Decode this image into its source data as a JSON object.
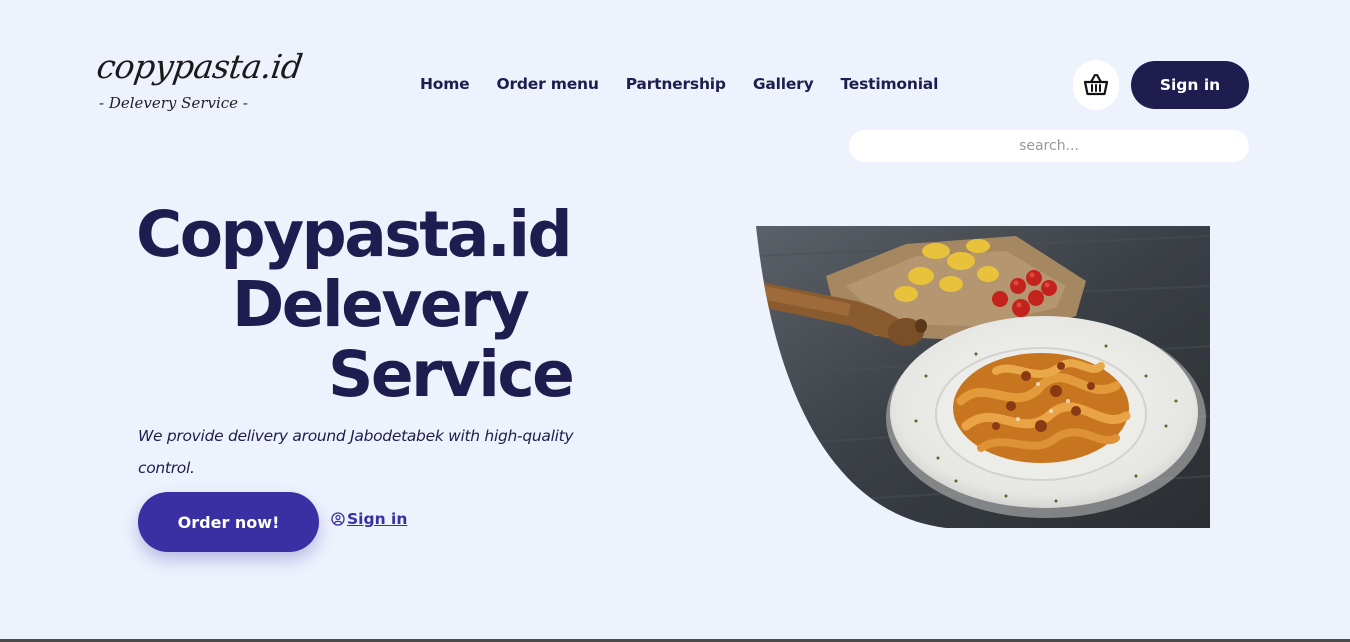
{
  "logo": {
    "title": "copypasta.id",
    "subtitle": "- Delevery Service -"
  },
  "nav": {
    "items": [
      "Home",
      "Order menu",
      "Partnership",
      "Gallery",
      "Testimonial"
    ]
  },
  "header": {
    "cart_icon": "basket-icon",
    "signin_label": "Sign in",
    "search_placeholder": "search..."
  },
  "hero": {
    "title_line1": "Copypasta.id",
    "title_line2": "Delevery",
    "title_line3": "Service",
    "description": "We provide delivery around Jabodetabek with high-quality control.",
    "order_button": "Order now!",
    "signin_link": "Sign in",
    "signin_icon": "user-circle-icon"
  },
  "colors": {
    "background": "#eef2fd",
    "navy": "#1f1d4f",
    "accent": "#3a2fa3"
  }
}
